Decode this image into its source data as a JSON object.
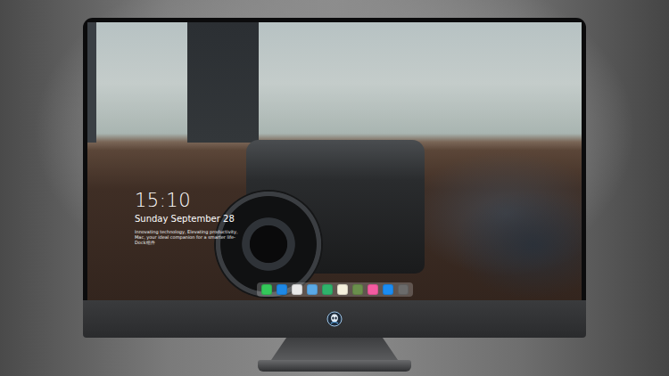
{
  "desktop": {
    "clock": {
      "time": "15:10",
      "date": "Sunday September 28",
      "tagline": "Innovating technology, Elevating productivity, Mac, your ideal companion for a smarter life- Dock组件"
    }
  },
  "dock": {
    "items": [
      {
        "color": "#34c759"
      },
      {
        "color": "#1e88e5"
      },
      {
        "color": "#e8e8e8"
      },
      {
        "color": "#5aa9e6"
      },
      {
        "color": "#2fb36b"
      },
      {
        "color": "#f5f0dc"
      },
      {
        "color": "#6a8f4c"
      },
      {
        "color": "#f45ba0"
      },
      {
        "color": "#1b8cf2"
      },
      {
        "color": "#6b6b6b"
      }
    ]
  }
}
